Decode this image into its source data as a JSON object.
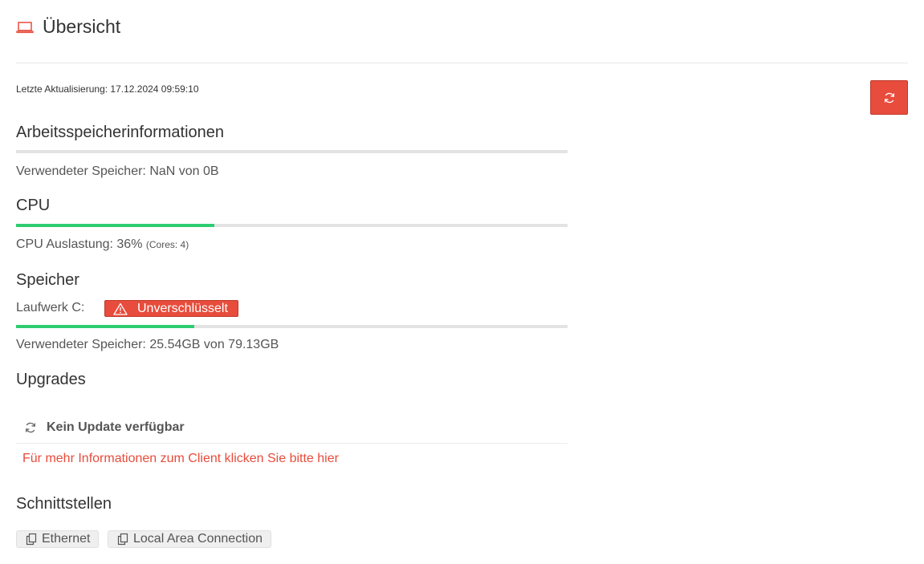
{
  "header": {
    "title": "Übersicht",
    "icon": "laptop-icon"
  },
  "status": {
    "last_update": "Letzte Aktualisierung: 17.12.2024 09:59:10"
  },
  "refresh_button": {
    "icon": "refresh-icon",
    "color": "#e74c3c"
  },
  "memory": {
    "title": "Arbeitsspeicherinformationen",
    "usage_text": "Verwendeter Speicher: NaN von 0B",
    "progress_percent": 0
  },
  "cpu": {
    "title": "CPU",
    "usage_text": "CPU Auslastung: 36%",
    "cores_text": "(Cores: 4)",
    "progress_percent": 36
  },
  "storage": {
    "title": "Speicher",
    "drive_label": "Laufwerk C:",
    "badge_label": "Unverschlüsselt",
    "badge_icon": "warning-icon",
    "usage_text": "Verwendeter Speicher: 25.54GB von 79.13GB",
    "progress_percent": 32.3
  },
  "upgrades": {
    "title": "Upgrades",
    "status_label": "Kein Update verfügbar",
    "status_icon": "refresh-icon",
    "info_link": "Für mehr Informationen zum Client klicken Sie bitte hier"
  },
  "interfaces": {
    "title": "Schnittstellen",
    "items": [
      {
        "label": "Ethernet",
        "icon": "copy-icon"
      },
      {
        "label": "Local Area Connection",
        "icon": "copy-icon"
      }
    ]
  },
  "colors": {
    "accent": "#e74c3c",
    "progress": "#2ecc71",
    "track": "#e3e3e3"
  }
}
